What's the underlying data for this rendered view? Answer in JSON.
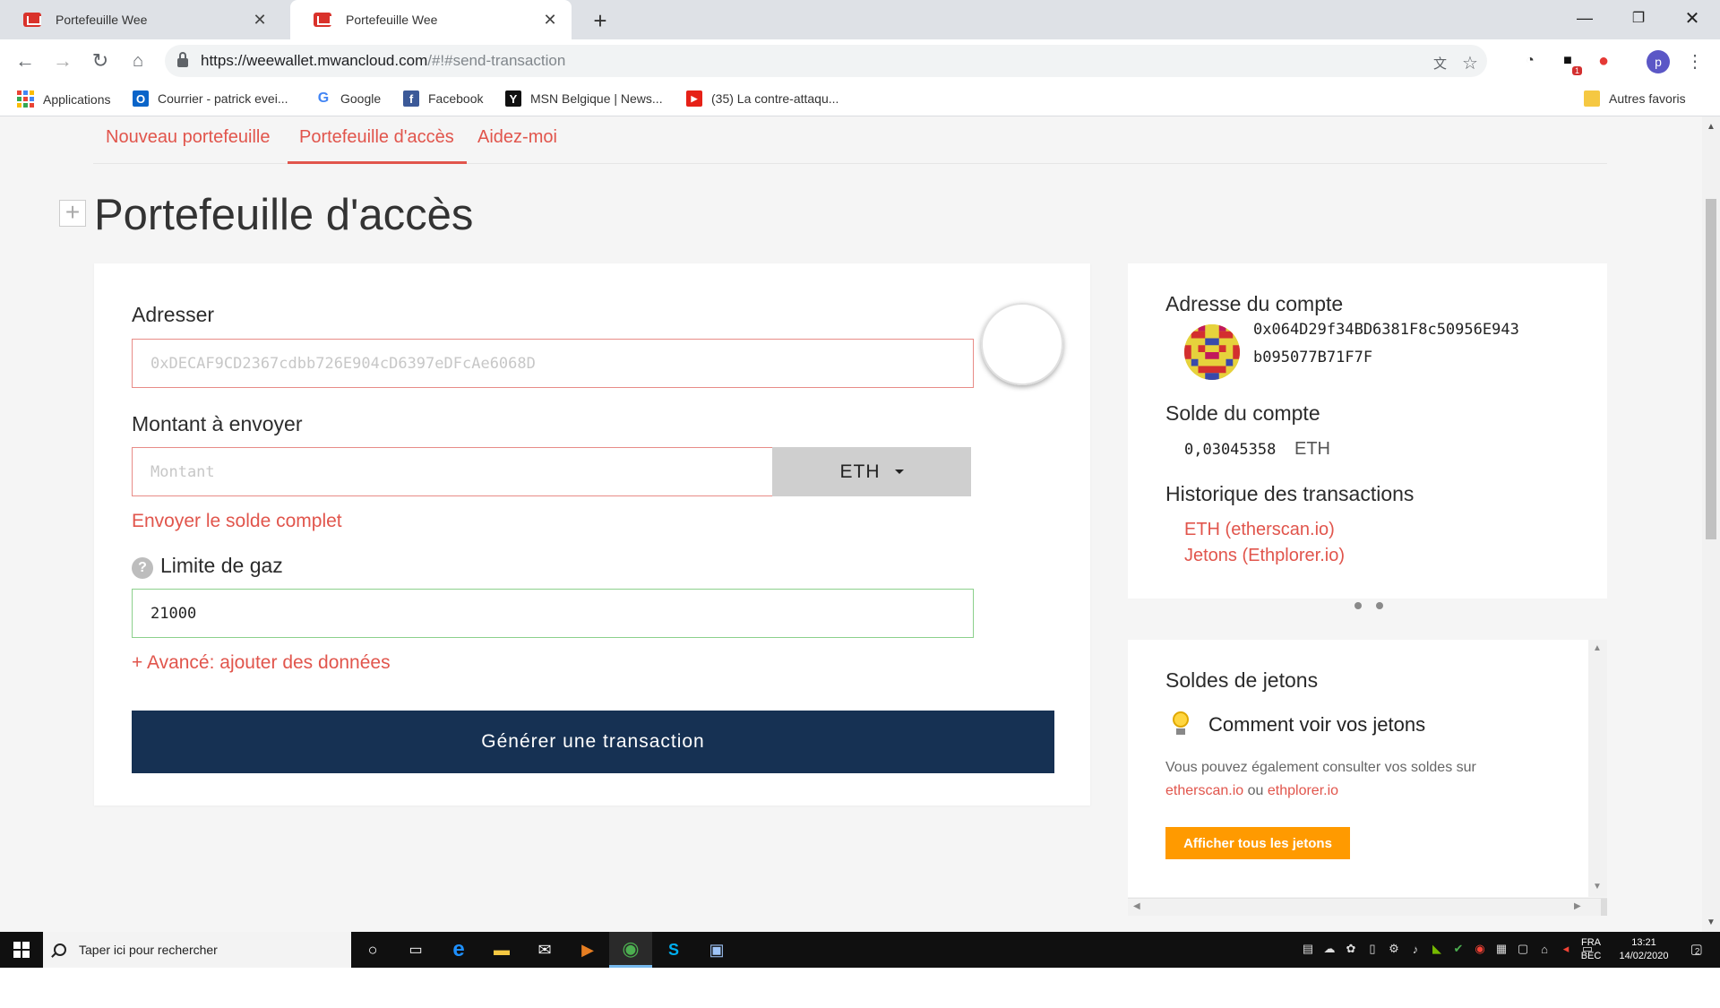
{
  "browser": {
    "tabs": [
      {
        "title": "Portefeuille Wee",
        "active": false
      },
      {
        "title": "Portefeuille Wee",
        "active": true
      }
    ],
    "new_tab_icon": "plus-icon",
    "url_host": "https://weewallet.mwancloud.com",
    "url_path": "/#!#send-transaction",
    "bookmarks": [
      {
        "label": "Applications",
        "icon": "apps-grid-icon"
      },
      {
        "label": "Courrier - patrick evei...",
        "icon": "outlook-icon"
      },
      {
        "label": "Google",
        "icon": "google-icon"
      },
      {
        "label": "Facebook",
        "icon": "facebook-icon"
      },
      {
        "label": "MSN Belgique | News...",
        "icon": "msn-icon"
      },
      {
        "label": "(35) La contre-attaqu...",
        "icon": "youtube-icon"
      }
    ],
    "other_bookmarks": "Autres favoris",
    "profile_initial": "p",
    "extension_badge": "1"
  },
  "subnav": {
    "items": [
      "Nouveau portefeuille",
      "Portefeuille d'accès",
      "Aidez-moi"
    ],
    "active_index": 1
  },
  "page_title": "Portefeuille d'accès",
  "form": {
    "address_label": "Adresser",
    "address_placeholder": "0xDECAF9CD2367cdbb726E904cD6397eDFcAe6068D",
    "amount_label": "Montant à envoyer",
    "amount_placeholder": "Montant",
    "currency": "ETH",
    "send_all_link": "Envoyer le solde complet",
    "gas_help": "?",
    "gas_label": "Limite de gaz",
    "gas_value": "21000",
    "advanced_link": "+ Avancé: ajouter des données",
    "generate_button": "Générer une transaction"
  },
  "account": {
    "address_heading": "Adresse du compte",
    "address_line1": "0x064D29f34BD6381F8c50956E943",
    "address_line2": "b095077B71F7F",
    "balance_heading": "Solde du compte",
    "balance_value": "0,03045358",
    "balance_unit": "ETH",
    "history_heading": "Historique des transactions",
    "history_links": [
      "ETH (etherscan.io)",
      "Jetons (Ethplorer.io)"
    ]
  },
  "tokens": {
    "heading": "Soldes de jetons",
    "subheading": "Comment voir vos jetons",
    "text_before": "Vous pouvez également consulter vos soldes sur",
    "link1": "etherscan.io",
    "text_mid": "ou",
    "link2": "ethplorer.io",
    "button": "Afficher tous les jetons"
  },
  "taskbar": {
    "search_placeholder": "Taper ici pour rechercher",
    "lang_top": "FRA",
    "lang_bottom": "BEC",
    "time": "13:21",
    "date": "14/02/2020",
    "notification_count": "2"
  },
  "colors": {
    "accent_red": "#e1554c",
    "navy_button": "#163153",
    "orange_button": "#ff9a00",
    "valid_green": "#8cd08c"
  }
}
